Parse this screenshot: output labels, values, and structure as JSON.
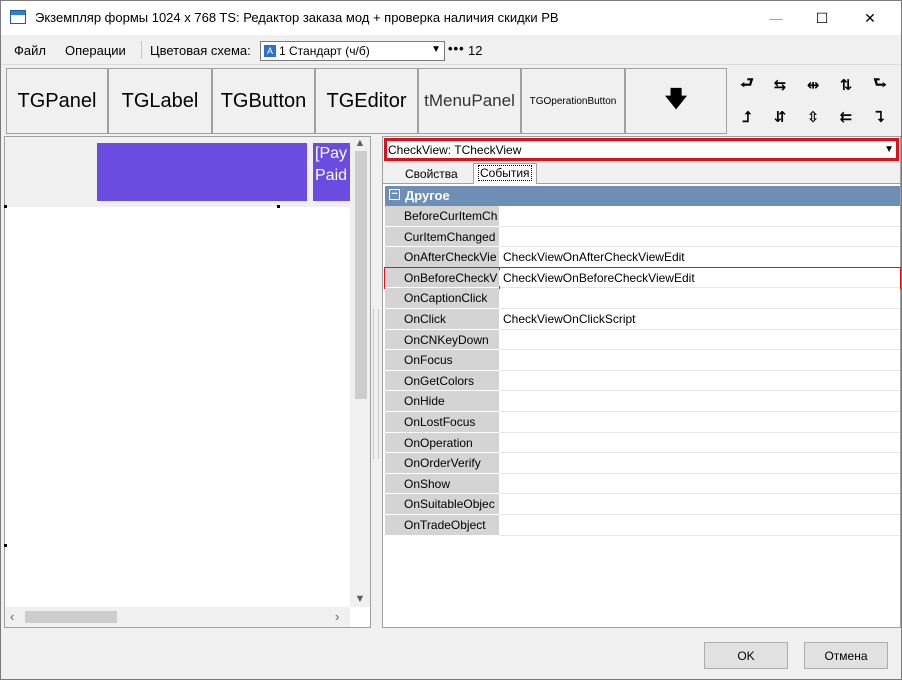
{
  "window": {
    "title": "Экземпляр формы 1024 x 768 TS: Редактор заказа мод + проверка наличия скидки PB",
    "minimize": "—",
    "maximize": "☐",
    "close": "✕"
  },
  "menu": {
    "file": "Файл",
    "operations": "Операции",
    "scheme_label": "Цветовая схема:",
    "scheme_value": "1 Стандарт (ч/б)",
    "scheme_icon": "A",
    "dots": "•••",
    "count": "12"
  },
  "components": [
    {
      "label": "TGPanel"
    },
    {
      "label": "TGLabel"
    },
    {
      "label": "TGButton"
    },
    {
      "label": "TGEditor"
    },
    {
      "label": "tMenuPanel"
    },
    {
      "label": "TGOperationButton"
    },
    {
      "label": "🡇"
    }
  ],
  "align_tools": [
    {
      "glyph": "⮐"
    },
    {
      "glyph": "⇆"
    },
    {
      "glyph": "⇹"
    },
    {
      "glyph": "⇅"
    },
    {
      "glyph": "⮑"
    },
    {
      "glyph": "⮥"
    },
    {
      "glyph": "⇵"
    },
    {
      "glyph": "⇳"
    },
    {
      "glyph": "⇇"
    },
    {
      "glyph": "⮧"
    }
  ],
  "canvas": {
    "pay_text": "[Pay Paid"
  },
  "scroll": {
    "up": "▲",
    "down": "▼",
    "left": "‹",
    "right": "›"
  },
  "inspector": {
    "object": "CheckView: TCheckView",
    "object_arrow": "▼",
    "tab_properties": "Свойства",
    "tab_events": "События",
    "category_minus": "−",
    "category": "Другое",
    "rows": [
      {
        "name": "BeforeCurItemCh",
        "value": ""
      },
      {
        "name": "CurItemChanged",
        "value": ""
      },
      {
        "name": "OnAfterCheckVie",
        "value": "CheckViewOnAfterCheckViewEdit"
      },
      {
        "name": "OnBeforeCheckV",
        "value": "CheckViewOnBeforeCheckViewEdit"
      },
      {
        "name": "OnCaptionClick",
        "value": ""
      },
      {
        "name": "OnClick",
        "value": "CheckViewOnClickScript"
      },
      {
        "name": "OnCNKeyDown",
        "value": ""
      },
      {
        "name": "OnFocus",
        "value": ""
      },
      {
        "name": "OnGetColors",
        "value": ""
      },
      {
        "name": "OnHide",
        "value": ""
      },
      {
        "name": "OnLostFocus",
        "value": ""
      },
      {
        "name": "OnOperation",
        "value": ""
      },
      {
        "name": "OnOrderVerify",
        "value": ""
      },
      {
        "name": "OnShow",
        "value": ""
      },
      {
        "name": "OnSuitableObjec",
        "value": ""
      },
      {
        "name": "OnTradeObject",
        "value": ""
      }
    ]
  },
  "buttons": {
    "ok": "OK",
    "cancel": "Отмена"
  }
}
